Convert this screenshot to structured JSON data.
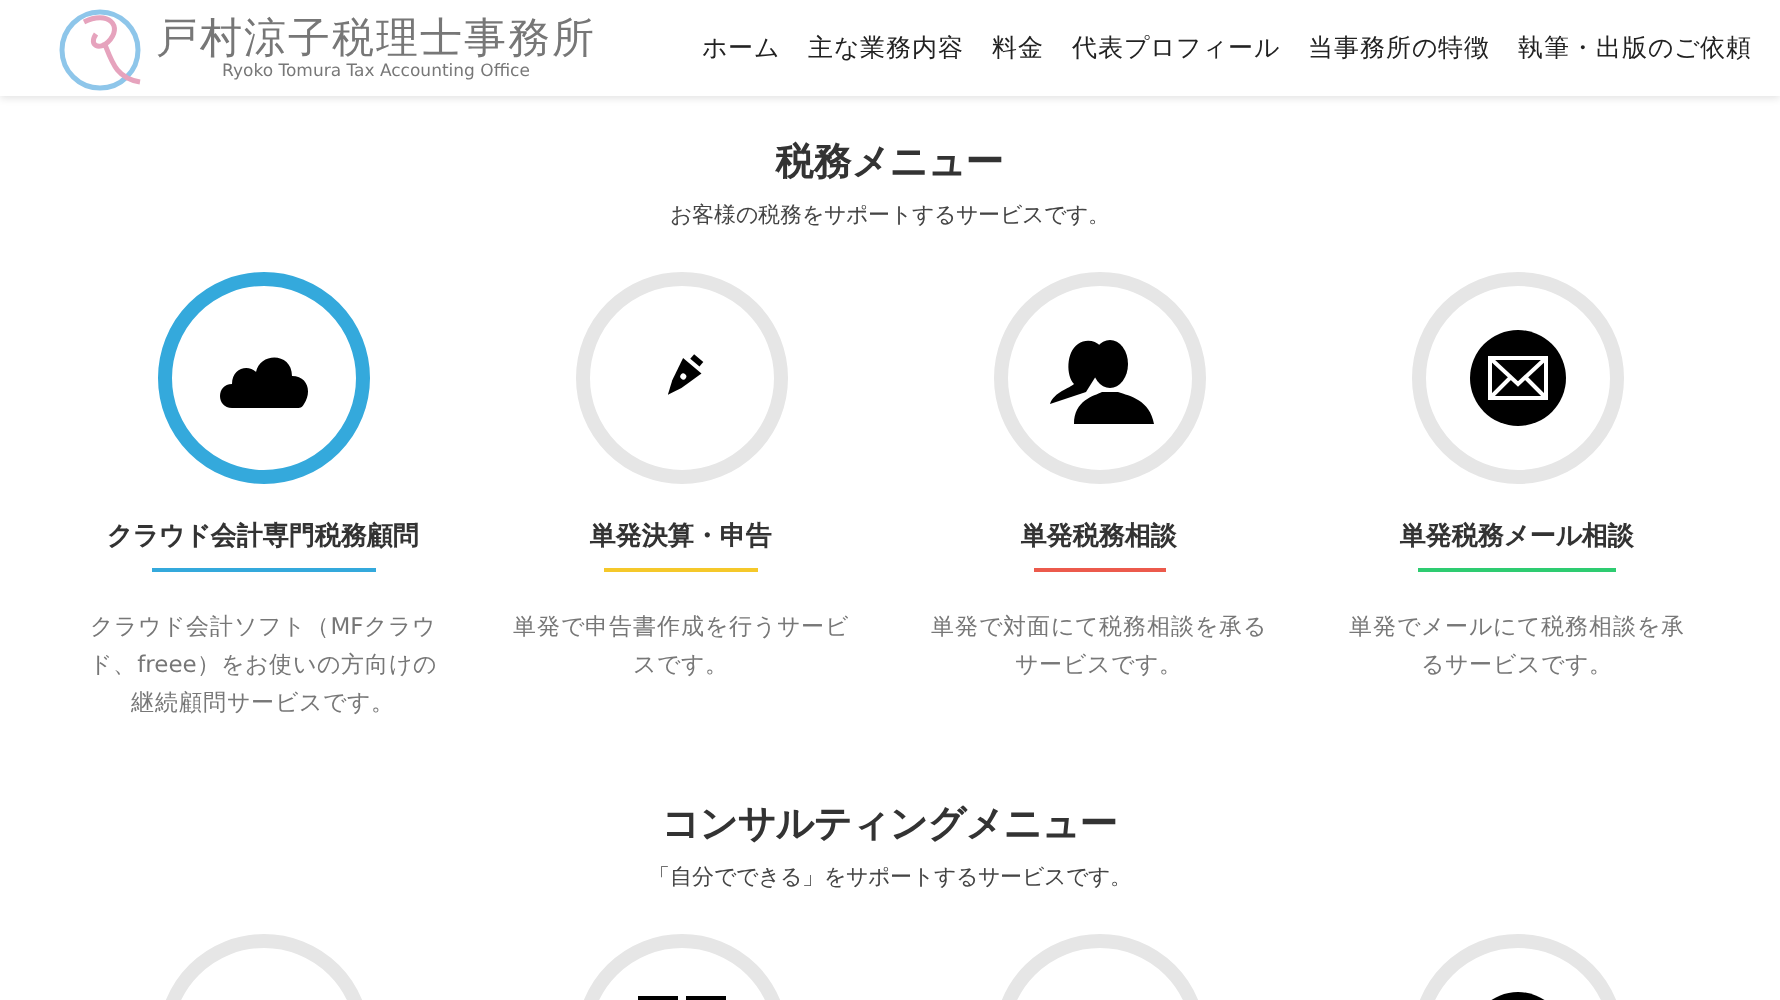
{
  "header": {
    "logo_title": "戸村涼子税理士事務所",
    "logo_subtitle": "Ryoko Tomura Tax Accounting Office",
    "nav": [
      {
        "label": "ホーム"
      },
      {
        "label": "主な業務内容"
      },
      {
        "label": "料金"
      },
      {
        "label": "代表プロフィール"
      },
      {
        "label": "当事務所の特徴"
      },
      {
        "label": "執筆・出版のご依頼"
      }
    ]
  },
  "sections": [
    {
      "title": "税務メニュー",
      "subtitle": "お客様の税務をサポートするサービスです。",
      "cards": [
        {
          "title": "クラウド会計専門税務顧問",
          "description": "クラウド会計ソフト（MFクラウド、freee）をお使いの方向けの継続顧問サービスです。",
          "active": true,
          "color": "#34a9dc"
        },
        {
          "title": "単発決算・申告",
          "description": "単発で申告書作成を行うサービスです。",
          "active": false,
          "color": "#f5c82a"
        },
        {
          "title": "単発税務相談",
          "description": "単発で対面にて税務相談を承るサービスです。",
          "active": false,
          "color": "#ec5a4c"
        },
        {
          "title": "単発税務メール相談",
          "description": "単発でメールにて税務相談を承るサービスです。",
          "active": false,
          "color": "#2ecc71"
        }
      ]
    },
    {
      "title": "コンサルティングメニュー",
      "subtitle": "「自分でできる」をサポートするサービスです。",
      "cards": [
        {
          "active": false
        },
        {
          "active": false
        },
        {
          "active": false
        },
        {
          "active": false
        }
      ]
    }
  ]
}
